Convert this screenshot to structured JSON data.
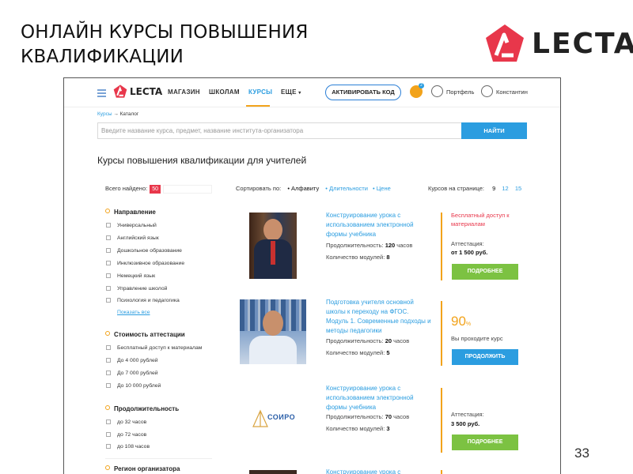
{
  "slide": {
    "title_line1": "ОНЛАЙН КУРСЫ ПОВЫШЕНИЯ",
    "title_line2": "КВАЛИФИКАЦИИ",
    "logo_text": "LECTA",
    "page_number": "33"
  },
  "header": {
    "logo_text": "LECTA",
    "nav": [
      "МАГАЗИН",
      "ШКОЛАМ",
      "КУРСЫ",
      "ЕЩЕ"
    ],
    "activate_label": "АКТИВИРОВАТЬ КОД",
    "cart_count": "2",
    "portfolio_label": "Портфель",
    "user_name": "Константин"
  },
  "breadcrumb": {
    "root": "Курсы",
    "sep": "→",
    "current": "Каталог"
  },
  "search": {
    "placeholder": "Введите название курса, предмет, название института-организатора",
    "button": "НАЙТИ"
  },
  "page_title": "Курсы повышения квалификации для учителей",
  "toolbar": {
    "found_label": "Всего найдено:",
    "found_count": "50",
    "sort_label": "Сортировать по:",
    "sort_options": [
      "Алфавиту",
      "Длительности",
      "Цене"
    ],
    "per_page_label": "Курсов на странице:",
    "per_page_options": [
      "9",
      "12",
      "15"
    ]
  },
  "filters": {
    "direction": {
      "title": "Направление",
      "items": [
        "Универсальный",
        "Английский язык",
        "Дошкольное образование",
        "Инклюзивное образование",
        "Немецкий язык",
        "Управление школой",
        "Психология и педагогика"
      ],
      "show_all": "Показать все"
    },
    "cost": {
      "title": "Стоимость аттестации",
      "items": [
        "Бесплатный доступ к материалам",
        "До 4 000 рублей",
        "До 7 000 рублей",
        "До 10 000 рублей"
      ]
    },
    "duration": {
      "title": "Продолжительность",
      "items": [
        "до 32 часов",
        "до 72 часов",
        "до 108 часов"
      ]
    },
    "region": {
      "title": "Регион организатора"
    }
  },
  "courses": [
    {
      "title": "Конструирование урока с использованием электронной формы учебника",
      "duration_label": "Продолжительность:",
      "duration": "120",
      "hours_unit": "часов",
      "modules_label": "Количество модулей:",
      "modules": "8",
      "free_access": "Бесплатный доступ к материалам",
      "attestation_label": "Аттестация:",
      "price": "от 1 500 руб.",
      "button": "ПОДРОБНЕЕ"
    },
    {
      "title": "Подготовка учителя основной школы к переходу на ФГОС. Модуль 1. Современные подходы и методы педагогики",
      "duration_label": "Продолжительность:",
      "duration": "20",
      "hours_unit": "часов",
      "modules_label": "Количество модулей:",
      "modules": "5",
      "progress_value": "90",
      "progress_unit": "%",
      "progress_text": "Вы проходите курс",
      "button": "ПРОДОЛЖИТЬ"
    },
    {
      "title": "Конструирование урока с использованием электронной формы учебника",
      "duration_label": "Продолжительность:",
      "duration": "70",
      "hours_unit": "часов",
      "modules_label": "Количество модулей:",
      "modules": "3",
      "org_logo_text": "СОИРО",
      "attestation_label": "Аттестация:",
      "price": "3 500 руб.",
      "button": "ПОДРОБНЕЕ"
    },
    {
      "title": "Конструирование урока с"
    }
  ],
  "colors": {
    "accent": "#2b9de0",
    "orange": "#f2a31b",
    "green": "#7cc242",
    "red": "#e8374b",
    "logo_red": "#e8374b"
  }
}
